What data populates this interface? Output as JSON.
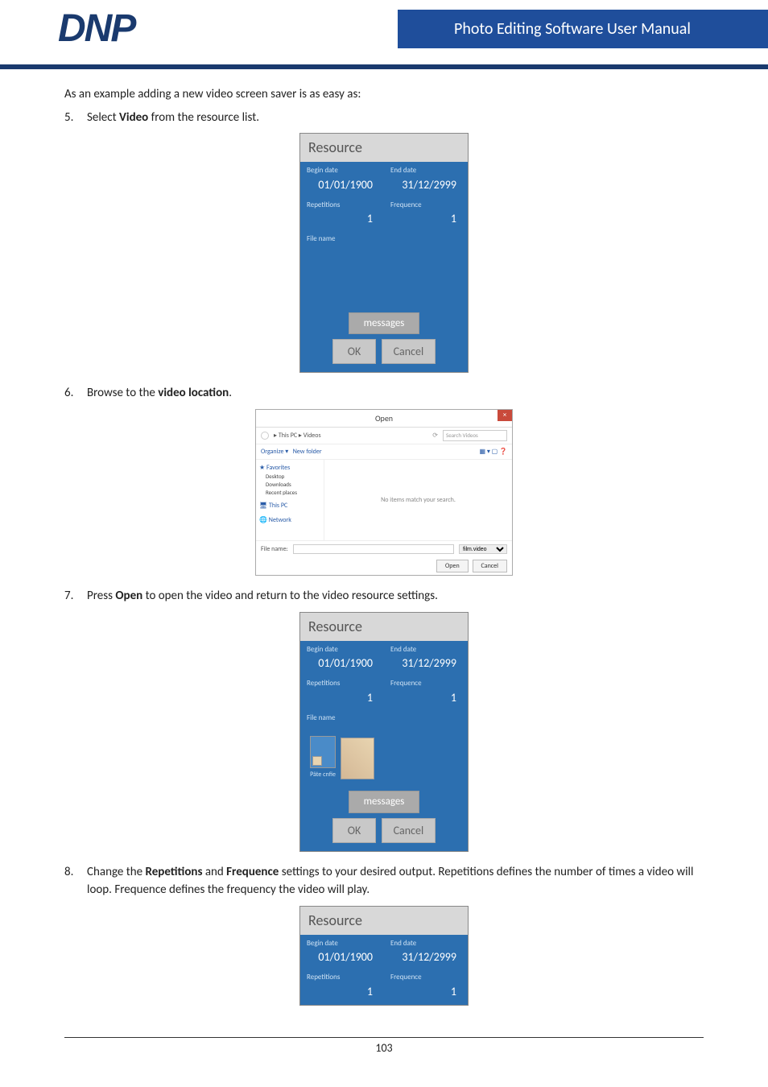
{
  "header": {
    "logo": "DNP",
    "banner": "Photo Editing Software User Manual"
  },
  "body": {
    "intro": "As an example adding a new video screen saver is as easy as:",
    "step5_num": "5.",
    "step5_a": "Select ",
    "step5_b": "Video",
    "step5_c": " from the resource list.",
    "step6_num": "6.",
    "step6_a": "Browse to the ",
    "step6_b": "video location",
    "step6_c": ".",
    "step7_num": "7.",
    "step7_a": "Press ",
    "step7_b": "Open",
    "step7_c": " to open the video and return to the video resource settings.",
    "step8_num": "8.",
    "step8_a": "Change the ",
    "step8_b": "Repetitions",
    "step8_c": " and ",
    "step8_d": "Frequence",
    "step8_e": " settings to your desired output. Repetitions defines the number of times a video will loop. Frequence defines the frequency the video will play."
  },
  "resource": {
    "title": "Resource",
    "begin_label": "Begin date",
    "begin_value": "01/01/1900",
    "end_label": "End date",
    "end_value": "31/12/2999",
    "rep_label": "Repetitions",
    "rep_value": "1",
    "freq_label": "Frequence",
    "freq_value": "1",
    "file_label": "File name",
    "messages": "messages",
    "ok": "OK",
    "cancel": "Cancel",
    "thumb_label": "Pâte cnfie"
  },
  "open_dialog": {
    "title": "Open",
    "path": "▸ This PC ▸ Videos",
    "search_ph": "Search Videos",
    "organize": "Organize ▾",
    "newfolder": "New folder",
    "favorites": "Favorites",
    "desktop": "Desktop",
    "downloads": "Downloads",
    "recent": "Recent places",
    "thispc": "This PC",
    "network": "Network",
    "noitems": "No items match your search.",
    "filename_label": "File name:",
    "filter": "film.video",
    "open": "Open",
    "cancel": "Cancel"
  },
  "footer": {
    "page": "103"
  }
}
